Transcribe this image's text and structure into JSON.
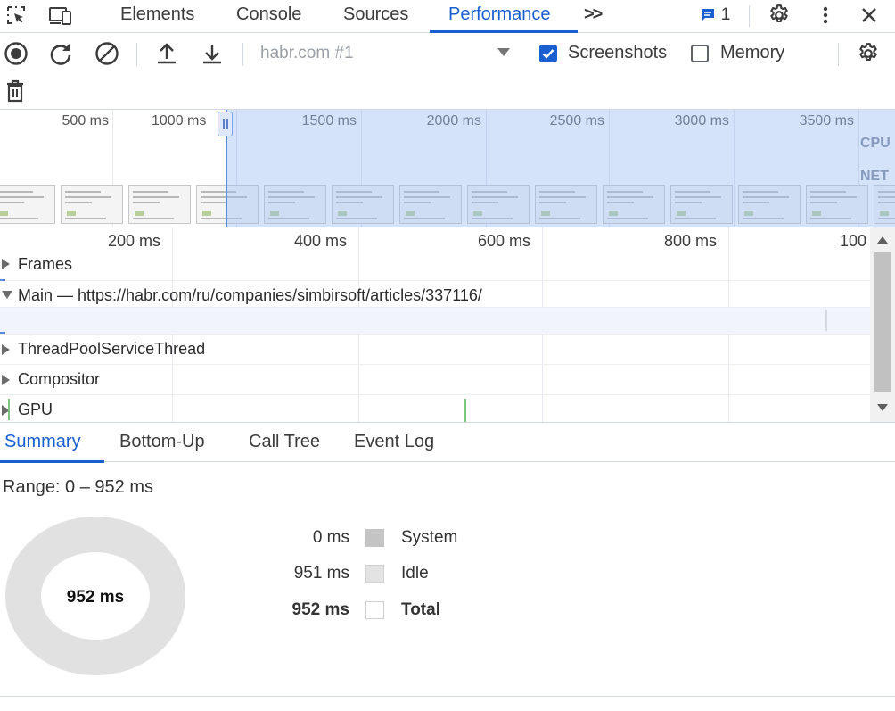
{
  "devtools": {
    "tabs": [
      "Elements",
      "Console",
      "Sources",
      "Performance"
    ],
    "active_tab": "Performance",
    "more_tabs_label": ">>",
    "messages_count": "1"
  },
  "toolbar": {
    "profile_select": "habr.com #1",
    "screenshots_label": "Screenshots",
    "screenshots_checked": true,
    "memory_label": "Memory",
    "memory_checked": false
  },
  "overview": {
    "ticks": [
      "500 ms",
      "1000 ms",
      "1500 ms",
      "2000 ms",
      "2500 ms",
      "3000 ms",
      "3500 ms"
    ],
    "cpu_label": "CPU",
    "net_label": "NET"
  },
  "timeline": {
    "ticks": [
      "200 ms",
      "400 ms",
      "600 ms",
      "800 ms",
      "100"
    ],
    "tracks": [
      {
        "name": "Frames",
        "expanded": false
      },
      {
        "name": "Main — https://habr.com/ru/companies/simbirsoft/articles/337116/",
        "expanded": true
      },
      {
        "name": "ThreadPoolServiceThread",
        "expanded": false
      },
      {
        "name": "Compositor",
        "expanded": false
      },
      {
        "name": "GPU",
        "expanded": false
      }
    ]
  },
  "bottom_tabs": [
    "Summary",
    "Bottom-Up",
    "Call Tree",
    "Event Log"
  ],
  "active_bottom_tab": "Summary",
  "summary": {
    "range": "Range: 0 – 952 ms",
    "total_center": "952 ms",
    "rows": [
      {
        "value": "0 ms",
        "label": "System",
        "color": "#c4c4c4",
        "bold": false
      },
      {
        "value": "951 ms",
        "label": "Idle",
        "color": "#e3e3e3",
        "bold": false
      },
      {
        "value": "952 ms",
        "label": "Total",
        "color": "#ffffff",
        "bold": true
      }
    ]
  },
  "colors": {
    "accent": "#1a5fd0",
    "selection": "#99baf3",
    "donut": "#e1e1e1"
  }
}
